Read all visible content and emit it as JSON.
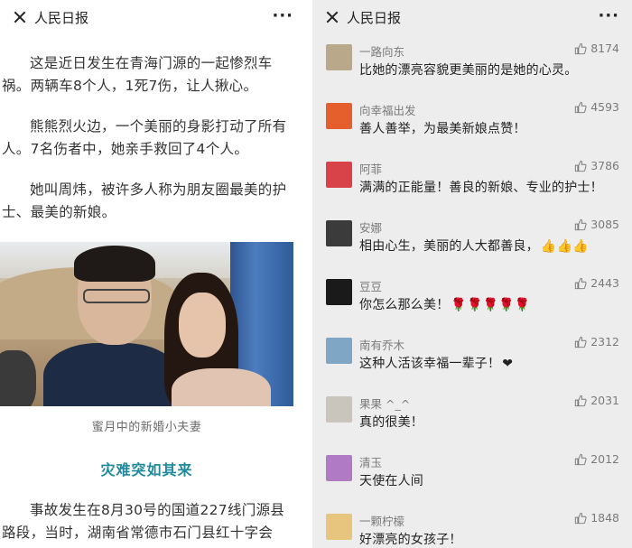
{
  "left": {
    "title": "人民日报",
    "more": "···",
    "paragraphs": [
      "这是近日发生在青海门源的一起惨烈车祸。两辆车8个人，1死7伤，让人揪心。",
      "熊熊烈火边，一个美丽的身影打动了所有人。7名伤者中，她亲手救回了4个人。",
      "她叫周炜，被许多人称为朋友圈最美的护士、最美的新娘。"
    ],
    "caption": "蜜月中的新婚小夫妻",
    "subheading": "灾难突如其来",
    "last_paragraph": "事故发生在8月30号的国道227线门源县路段，当时，湖南省常德市石门县红十字会"
  },
  "right": {
    "title": "人民日报",
    "more": "···",
    "comments": [
      {
        "name": "一路向东",
        "text": "比她的漂亮容貌更美丽的是她的心灵。",
        "likes": "8174",
        "avatar_color": "#b9a98a"
      },
      {
        "name": "向幸福出发",
        "text": "善人善举，为最美新娘点赞！",
        "likes": "4593",
        "avatar_color": "#e45f2b"
      },
      {
        "name": "阿菲",
        "text": "满满的正能量！善良的新娘、专业的护士！",
        "likes": "3786",
        "avatar_color": "#d8434a"
      },
      {
        "name": "安娜",
        "text": "相由心生，美丽的人大都善良，",
        "likes": "3085",
        "avatar_color": "#3b3b3b",
        "suffix": "👍👍👍"
      },
      {
        "name": "豆豆",
        "text": "你怎么那么美！",
        "likes": "2443",
        "avatar_color": "#1a1a1a",
        "suffix": "🌹🌹🌹🌹🌹"
      },
      {
        "name": "南有乔木",
        "text": "这种人活该幸福一辈子！",
        "likes": "2312",
        "avatar_color": "#7fa6c5",
        "suffix": "❤"
      },
      {
        "name": "果果 ^_^",
        "text": "真的很美！",
        "likes": "2031",
        "avatar_color": "#c9c5bd"
      },
      {
        "name": "清玉",
        "text": "天使在人间",
        "likes": "2012",
        "avatar_color": "#b07ac4"
      },
      {
        "name": "一颗柠檬",
        "text": "好漂亮的女孩子！",
        "likes": "1848",
        "avatar_color": "#e8c57e"
      }
    ]
  }
}
